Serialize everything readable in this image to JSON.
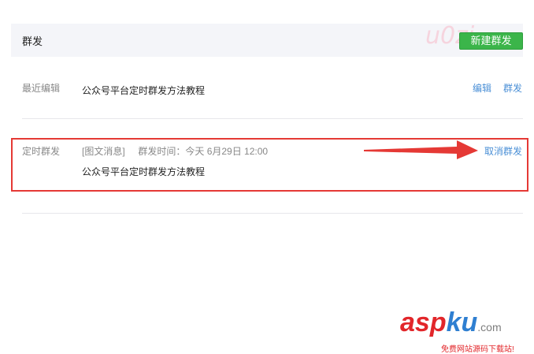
{
  "header": {
    "title": "群发",
    "new_button": "新建群发"
  },
  "recent": {
    "label": "最近编辑",
    "title": "公众号平台定时群发方法教程",
    "edit": "编辑",
    "send": "群发"
  },
  "scheduled": {
    "label": "定时群发",
    "type": "[图文消息]",
    "time_label": "群发时间：今天 6月29日 12:00",
    "title": "公众号平台定时群发方法教程",
    "cancel": "取消群发"
  },
  "watermark": {
    "top": "u0zi",
    "logo_asp": "asp",
    "logo_ku": "ku",
    "logo_com": ".com",
    "logo_sub": "免费网站源码下载站!"
  },
  "colors": {
    "accent_link": "#4a8fd6",
    "button_green": "#3bb54a",
    "highlight_red": "#e53935",
    "arrow_red": "#e53935"
  }
}
